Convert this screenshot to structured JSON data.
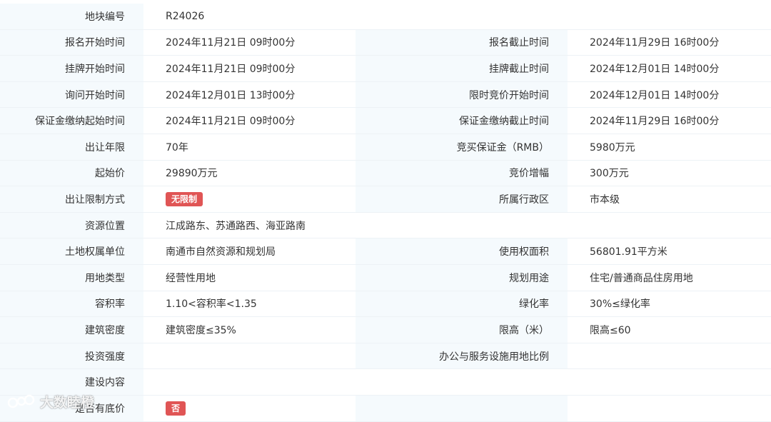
{
  "rows": [
    {
      "label": "地块编号",
      "value": "R24026"
    },
    {
      "label": "报名开始时间",
      "value": "2024年11月21日 09时00分",
      "label2": "报名截止时间",
      "value2": "2024年11月29日 16时00分"
    },
    {
      "label": "挂牌开始时间",
      "value": "2024年11月21日 09时00分",
      "label2": "挂牌截止时间",
      "value2": "2024年12月01日 14时00分"
    },
    {
      "label": "询问开始时间",
      "value": "2024年12月01日 13时00分",
      "label2": "限时竞价开始时间",
      "value2": "2024年12月01日 14时00分"
    },
    {
      "label": "保证金缴纳起始时间",
      "value": "2024年11月21日 09时00分",
      "label2": "保证金缴纳截止时间",
      "value2": "2024年11月29日 16时00分"
    },
    {
      "label": "出让年限",
      "value": "70年",
      "label2": "竞买保证金（RMB）",
      "value2": "5980万元"
    },
    {
      "label": "起始价",
      "value": "29890万元",
      "label2": "竞价增幅",
      "value2": "300万元"
    },
    {
      "label": "出让限制方式",
      "value": "无限制",
      "label2": "所属行政区",
      "value2": "市本级"
    },
    {
      "label": "资源位置",
      "value": "江成路东、苏通路西、海亚路南"
    },
    {
      "label": "土地权属单位",
      "value": "南通市自然资源和规划局",
      "label2": "使用权面积",
      "value2": "56801.91平方米"
    },
    {
      "label": "用地类型",
      "value": "经营性用地",
      "label2": "规划用途",
      "value2": "住宅/普通商品住房用地"
    },
    {
      "label": "容积率",
      "value": "1.10<容积率<1.35",
      "label2": "绿化率",
      "value2": "30%≤绿化率"
    },
    {
      "label": "建筑密度",
      "value": "建筑密度≤35%",
      "label2": "限高（米）",
      "value2": "限高≤60"
    },
    {
      "label": "投资强度",
      "value": "",
      "label2": "办公与服务设施用地比例",
      "value2": ""
    },
    {
      "label": "建设内容",
      "value": ""
    },
    {
      "label": "是否有底价",
      "value": "否",
      "label2": "",
      "value2": ""
    }
  ],
  "colors": {
    "label_bg": "#f5fafd",
    "badge": "#e05555",
    "border": "#edf2f6"
  },
  "watermark": {
    "text": "大数睦橙",
    "logo_icon": "brand-logo-icon"
  }
}
